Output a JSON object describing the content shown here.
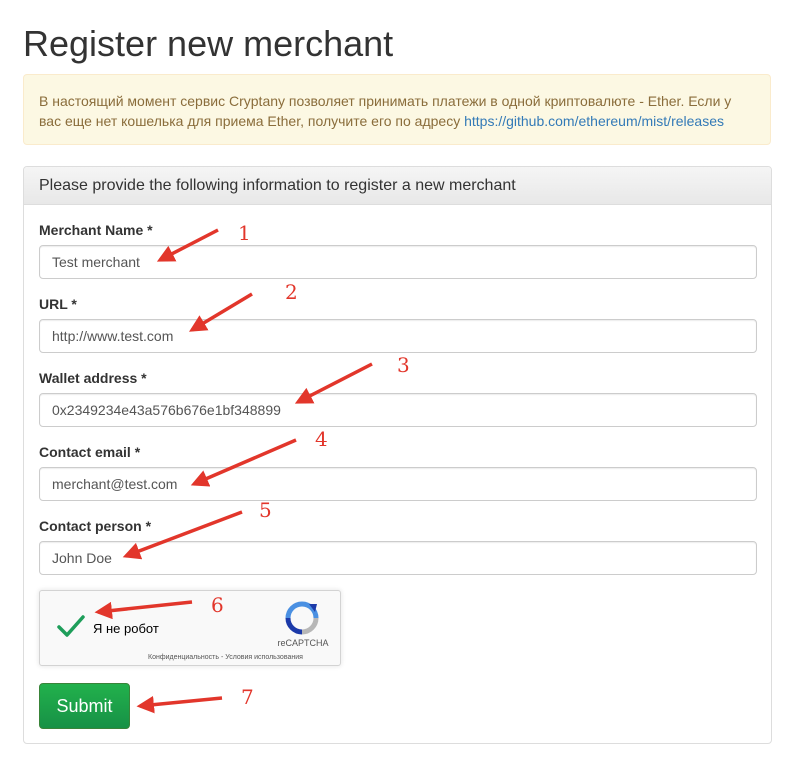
{
  "page": {
    "title": "Register new merchant"
  },
  "notice": {
    "text": "В настоящий момент сервис Cryptany позволяет принимать платежи в одной криптовалюте - Ether. Если у вас еще нет кошелька для приема Ether, получите его по адресу ",
    "link_text": "https://github.com/ethereum/mist/releases"
  },
  "panel": {
    "heading": "Please provide the following information to register a new merchant"
  },
  "form": {
    "merchant_name": {
      "label": "Merchant Name *",
      "value": "Test merchant"
    },
    "url": {
      "label": "URL *",
      "value": "http://www.test.com"
    },
    "wallet_address": {
      "label": "Wallet address *",
      "value": "0x2349234e43a576b676e1bf348899"
    },
    "contact_email": {
      "label": "Contact email *",
      "value": "merchant@test.com"
    },
    "contact_person": {
      "label": "Contact person *",
      "value": "John Doe"
    }
  },
  "recaptcha": {
    "checkbox_label": "Я не робот",
    "brand": "reCAPTCHA",
    "links": "Конфиденциальность - Условия использования",
    "checked": true,
    "check_color": "#1e9e5a"
  },
  "submit": {
    "label": "Submit",
    "color": "#1aa54c"
  },
  "annotations": {
    "color": "#e2362b",
    "numbers": [
      "1",
      "2",
      "3",
      "4",
      "5",
      "6",
      "7"
    ]
  }
}
